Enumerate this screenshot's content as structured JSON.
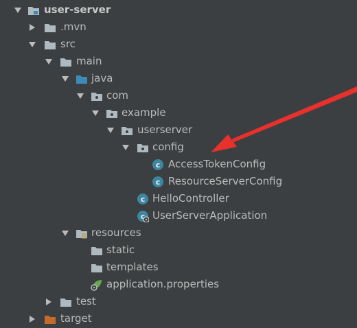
{
  "tree": {
    "root": {
      "label": "user-server"
    },
    "mvn": {
      "label": ".mvn"
    },
    "src": {
      "label": "src"
    },
    "main": {
      "label": "main"
    },
    "java": {
      "label": "java"
    },
    "com": {
      "label": "com"
    },
    "example": {
      "label": "example"
    },
    "userserver": {
      "label": "userserver"
    },
    "config": {
      "label": "config"
    },
    "access_token_config": {
      "label": "AccessTokenConfig"
    },
    "resource_server_config": {
      "label": "ResourceServerConfig"
    },
    "hello_controller": {
      "label": "HelloController"
    },
    "user_server_application": {
      "label": "UserServerApplication"
    },
    "resources": {
      "label": "resources"
    },
    "static": {
      "label": "static"
    },
    "templates": {
      "label": "templates"
    },
    "application_properties": {
      "label": "application.properties"
    },
    "test": {
      "label": "test"
    },
    "target": {
      "label": "target"
    }
  },
  "colors": {
    "background": "#3c3f41",
    "text": "#bbbbbb",
    "folder": "#aeb9c0",
    "source_folder": "#3d8ab4",
    "resources_folder": "#b9a76a",
    "excluded_folder": "#c26b2b",
    "class_icon": "#3e86a0",
    "annotation_arrow": "#e8302c"
  }
}
